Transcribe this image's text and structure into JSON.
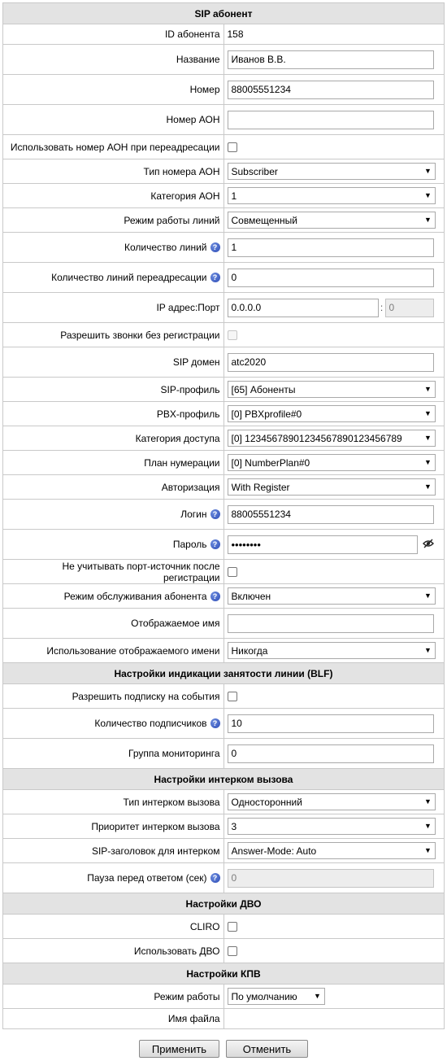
{
  "sip_section": {
    "title": "SIP абонент",
    "subscriber_id": {
      "label": "ID абонента",
      "value": "158"
    },
    "name": {
      "label": "Название",
      "value": "Иванов В.В."
    },
    "number": {
      "label": "Номер",
      "value": "88005551234"
    },
    "aon_number": {
      "label": "Номер АОН",
      "value": ""
    },
    "use_aon_redirect": {
      "label": "Использовать номер АОН при переадресации",
      "checked": false
    },
    "aon_type": {
      "label": "Тип номера АОН",
      "value": "Subscriber"
    },
    "aon_category": {
      "label": "Категория АОН",
      "value": "1"
    },
    "line_mode": {
      "label": "Режим работы линий",
      "value": "Совмещенный"
    },
    "line_count": {
      "label": "Количество линий",
      "value": "1"
    },
    "redirect_line_count": {
      "label": "Количество линий переадресации",
      "value": "0"
    },
    "ip_port": {
      "label": "IP адрес:Порт",
      "ip": "0.0.0.0",
      "separator": ":",
      "port": "0"
    },
    "allow_unregistered": {
      "label": "Разрешить звонки без регистрации",
      "checked": false
    },
    "sip_domain": {
      "label": "SIP домен",
      "value": "atc2020"
    },
    "sip_profile": {
      "label": "SIP-профиль",
      "value": "[65] Абоненты"
    },
    "pbx_profile": {
      "label": "PBX-профиль",
      "value": "[0] PBXprofile#0"
    },
    "access_category": {
      "label": "Категория доступа",
      "value": "[0] 12345678901234567890123456789"
    },
    "numbering_plan": {
      "label": "План нумерации",
      "value": "[0] NumberPlan#0"
    },
    "authorization": {
      "label": "Авторизация",
      "value": "With Register"
    },
    "login": {
      "label": "Логин",
      "value": "88005551234"
    },
    "password": {
      "label": "Пароль",
      "value": "••••••••"
    },
    "ignore_src_port": {
      "label": "Не учитывать порт-источник после регистрации",
      "checked": false
    },
    "service_mode": {
      "label": "Режим обслуживания абонента",
      "value": "Включен"
    },
    "display_name": {
      "label": "Отображаемое имя",
      "value": ""
    },
    "display_name_usage": {
      "label": "Использование отображаемого имени",
      "value": "Никогда"
    }
  },
  "blf_section": {
    "title": "Настройки индикации занятости линии (BLF)",
    "allow_subscribe": {
      "label": "Разрешить подписку на события",
      "checked": false
    },
    "subscriber_count": {
      "label": "Количество подписчиков",
      "value": "10"
    },
    "monitoring_group": {
      "label": "Группа мониторинга",
      "value": "0"
    }
  },
  "intercom_section": {
    "title": "Настройки интерком вызова",
    "type": {
      "label": "Тип интерком вызова",
      "value": "Односторонний"
    },
    "priority": {
      "label": "Приоритет интерком вызова",
      "value": "3"
    },
    "sip_header": {
      "label": "SIP-заголовок для интерком",
      "value": "Answer-Mode: Auto"
    },
    "answer_pause": {
      "label": "Пауза перед ответом (сек)",
      "value": "0"
    }
  },
  "dvo_section": {
    "title": "Настройки ДВО",
    "cliro": {
      "label": "CLIRO",
      "checked": false
    },
    "use_dvo": {
      "label": "Использовать ДВО",
      "checked": false
    }
  },
  "kpv_section": {
    "title": "Настройки КПВ",
    "mode": {
      "label": "Режим работы",
      "value": "По умолчанию"
    },
    "file_name": {
      "label": "Имя файла",
      "value": ""
    }
  },
  "buttons": {
    "apply": "Применить",
    "cancel": "Отменить"
  },
  "icons": {
    "help": "help-icon",
    "eye": "eye-off-icon",
    "dropdown": "chevron-down-icon"
  }
}
